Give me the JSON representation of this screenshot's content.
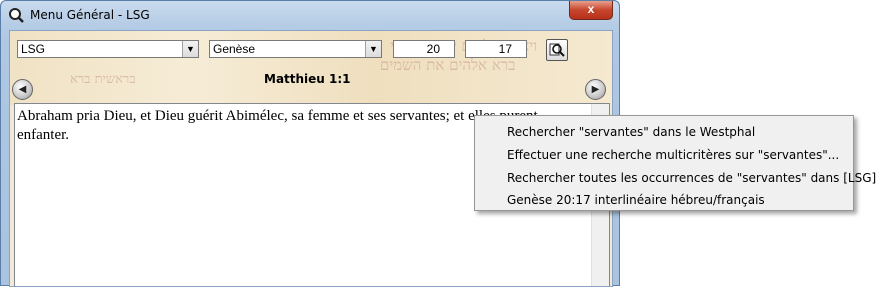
{
  "window": {
    "title": "Menu Général - LSG",
    "close_label": "x"
  },
  "toolbar": {
    "version_select": "LSG",
    "book_select": "Genèse",
    "chapter": "20",
    "verse": "17"
  },
  "reference": "Matthieu 1:1",
  "verse_text": "Abraham pria Dieu, et Dieu guérit Abimélec, sa femme et ses servantes; et elles purent enfanter.",
  "context_menu": {
    "items": [
      "Rechercher \"servantes\" dans le Westphal",
      "Effectuer une recherche multicritères sur \"servantes\"...",
      "Rechercher toutes les occurrences de \"servantes\" dans [LSG]",
      "Genèse 20:17 interlinéaire hébreu/français"
    ]
  },
  "icons": {
    "app": "magnifier-icon",
    "search": "magnifier-search-icon",
    "prev": "arrow-left-icon",
    "next": "arrow-right-icon",
    "dropdown": "chevron-down-icon"
  }
}
